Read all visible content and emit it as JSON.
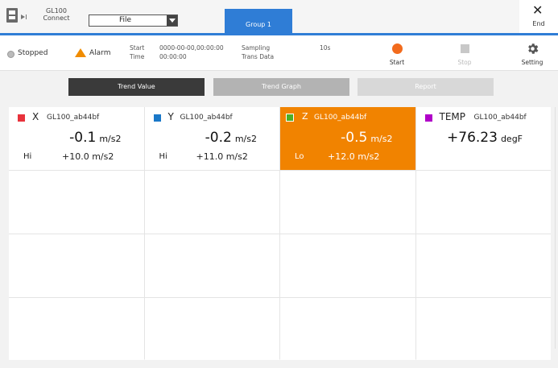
{
  "header": {
    "device_name_line1": "GL100",
    "device_name_line2": "Connect",
    "file_select_value": "File",
    "group_tab_label": "Group 1",
    "end_label": "End"
  },
  "status": {
    "state_text": "Stopped",
    "alarm_text": "Alarm",
    "start_label": "Start",
    "time_label": "Time",
    "start_value": "0000-00-00,00:00:00",
    "time_value": "00:00:00",
    "sampling_label": "Sampling",
    "trans_data_label": "Trans Data",
    "sampling_value": "10s",
    "actions": {
      "start": "Start",
      "stop": "Stop",
      "setting": "Setting"
    }
  },
  "view_buttons": {
    "trend_value": "Trend Value",
    "trend_graph": "Trend Graph",
    "report": "Report"
  },
  "channels": [
    {
      "name": "X",
      "device": "GL100_ab44bf",
      "value": "-0.1",
      "unit": "m/s2",
      "limit_type": "Hi",
      "limit_value": "+10.0 m/s2",
      "color": "#e8323c"
    },
    {
      "name": "Y",
      "device": "GL100_ab44bf",
      "value": "-0.2",
      "unit": "m/s2",
      "limit_type": "Hi",
      "limit_value": "+11.0 m/s2",
      "color": "#1a78c8"
    },
    {
      "name": "Z",
      "device": "GL100_ab44bf",
      "value": "-0.5",
      "unit": "m/s2",
      "limit_type": "Lo",
      "limit_value": "+12.0 m/s2",
      "color": "#4caf26",
      "alarm_bg": "#f18300"
    },
    {
      "name": "TEMP",
      "device": "GL100_ab44bf",
      "value": "+76.23",
      "unit": "degF",
      "limit_type": "",
      "limit_value": "",
      "color": "#b000c8"
    }
  ],
  "colors": {
    "accent_blue": "#2f7dd6",
    "start_orange": "#f26b1d",
    "alarm_orange": "#f08c00"
  }
}
